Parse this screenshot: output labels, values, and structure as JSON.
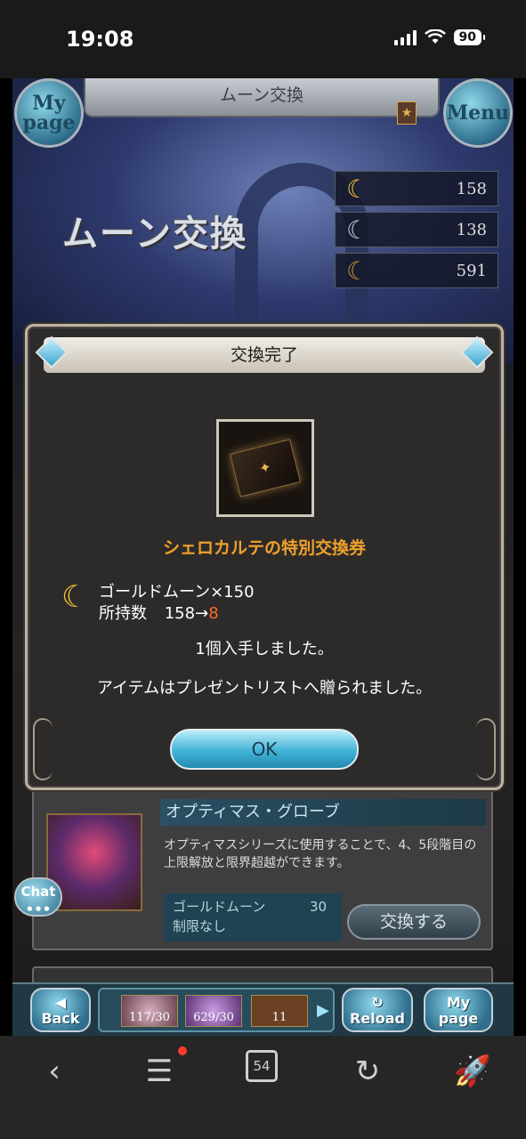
{
  "status_bar": {
    "time": "19:08",
    "battery": "90"
  },
  "header": {
    "title": "ムーン交換",
    "mypage_label": "My page",
    "menu_label": "Menu"
  },
  "banner": {
    "title": "ムーン交換",
    "moons": [
      {
        "type": "gold",
        "count": "158"
      },
      {
        "type": "silver",
        "count": "138"
      },
      {
        "type": "bronze",
        "count": "591"
      }
    ]
  },
  "modal": {
    "title": "交換完了",
    "item_name": "シェロカルテの特別交換券",
    "cost_label": "ゴールドムーン×150",
    "held_label": "所持数",
    "held_before": "158→",
    "held_after": "8",
    "message1": "1個入手しました。",
    "message2": "アイテムはプレゼントリストへ贈られました。",
    "ok_label": "OK"
  },
  "list_item": {
    "name": "オプティマス・グローブ",
    "description": "オプティマスシリーズに使用することで、4、5段階目の上限解放と限界超越ができます。",
    "currency": "ゴールドムーン",
    "cost": "30",
    "limit": "制限なし",
    "exchange_label": "交換する"
  },
  "chat_label": "Chat",
  "game_bar": {
    "back_label": "Back",
    "reload_label": "Reload",
    "mypage_label": "My page",
    "resources": [
      "117/30",
      "629/30",
      "11"
    ]
  },
  "browser_bar": {
    "tabs_count": "54"
  },
  "colors": {
    "accent_orange": "#f0a12a",
    "highlight_red": "#ff6a2a",
    "gold_moon": "#f2c230"
  }
}
